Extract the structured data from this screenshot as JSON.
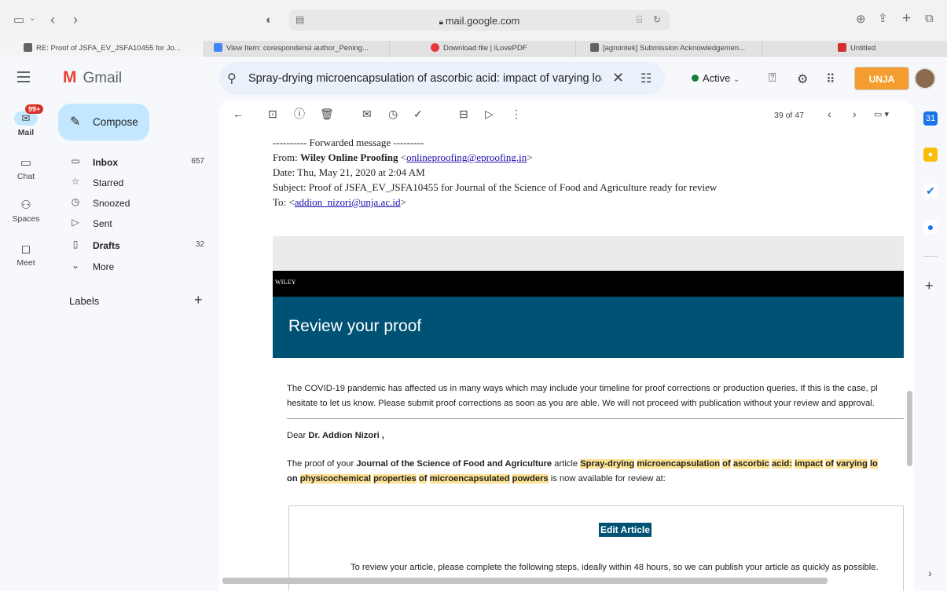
{
  "browser": {
    "url": "mail.google.com",
    "tabs": [
      {
        "label": "RE: Proof of JSFA_EV_JSFA10455 for Jo...",
        "color": "#5f6368",
        "glyph": "G"
      },
      {
        "label": "View Item: corespondensi author_Pening...",
        "color": "#4285f4",
        "glyph": "▯"
      },
      {
        "label": "Download file | iLovePDF",
        "color": "#e53935",
        "glyph": "♥"
      },
      {
        "label": "[agrointek] Submission Acknowledgemen...",
        "color": "#5f6368",
        "glyph": "G"
      },
      {
        "label": "Untitled",
        "color": "#d32f2f",
        "glyph": ""
      }
    ]
  },
  "gmail": {
    "app_name": "Gmail",
    "search_query": "Spray-drying microencapsulation of ascorbic acid: impact of varying loading",
    "status": "Active",
    "brand_badge": "UNJA"
  },
  "rail": {
    "mail_badge": "99+",
    "mail": "Mail",
    "chat": "Chat",
    "spaces": "Spaces",
    "meet": "Meet"
  },
  "nav": {
    "compose": "Compose",
    "inbox": "Inbox",
    "inbox_count": "657",
    "starred": "Starred",
    "snoozed": "Snoozed",
    "sent": "Sent",
    "drafts": "Drafts",
    "drafts_count": "32",
    "more": "More",
    "labels": "Labels"
  },
  "toolbar": {
    "counter": "39 of 47"
  },
  "email": {
    "fwd_header": "---------- Forwarded message ---------",
    "from_label": "From: ",
    "from_name": "Wiley Online Proofing",
    "from_email": "onlineproofing@eproofing.in",
    "date": "Date: Thu, May 21, 2020 at 2:04 AM",
    "subject": "Subject: Proof of JSFA_EV_JSFA10455 for Journal of the Science of Food and Agriculture ready for review",
    "to_label": "To: ",
    "to_email": "addion_nizori@unja.ac.id",
    "wiley": "WILEY",
    "banner": "Review your proof",
    "covid_1": "The COVID-19 pandemic has affected us in many ways which may include your timeline for proof corrections or production queries. If this is the case, pl",
    "covid_2": "hesitate to let us know. Please submit proof corrections as soon as you are able. We will not proceed with publication without your review and approval.",
    "dear": "Dear ",
    "dear_name": "Dr. Addion Nizori ,",
    "proof_1": "The proof of your ",
    "journal": "Journal of the Science of Food and Agriculture",
    "proof_2": " article ",
    "title_words_1": [
      "Spray-drying",
      "microencapsulation",
      "of",
      "ascorbic",
      "acid:",
      "impact",
      "of",
      "varying",
      "lo"
    ],
    "title_words_2": [
      "physicochemical",
      "properties",
      "of",
      "microencapsulated",
      "powders"
    ],
    "on": "on ",
    "proof_3": " is now available for review at:",
    "edit_button": "Edit Article",
    "steps": "To review your article, please complete the following steps, ideally within 48 hours, so we can publish your article as quickly as possible."
  }
}
